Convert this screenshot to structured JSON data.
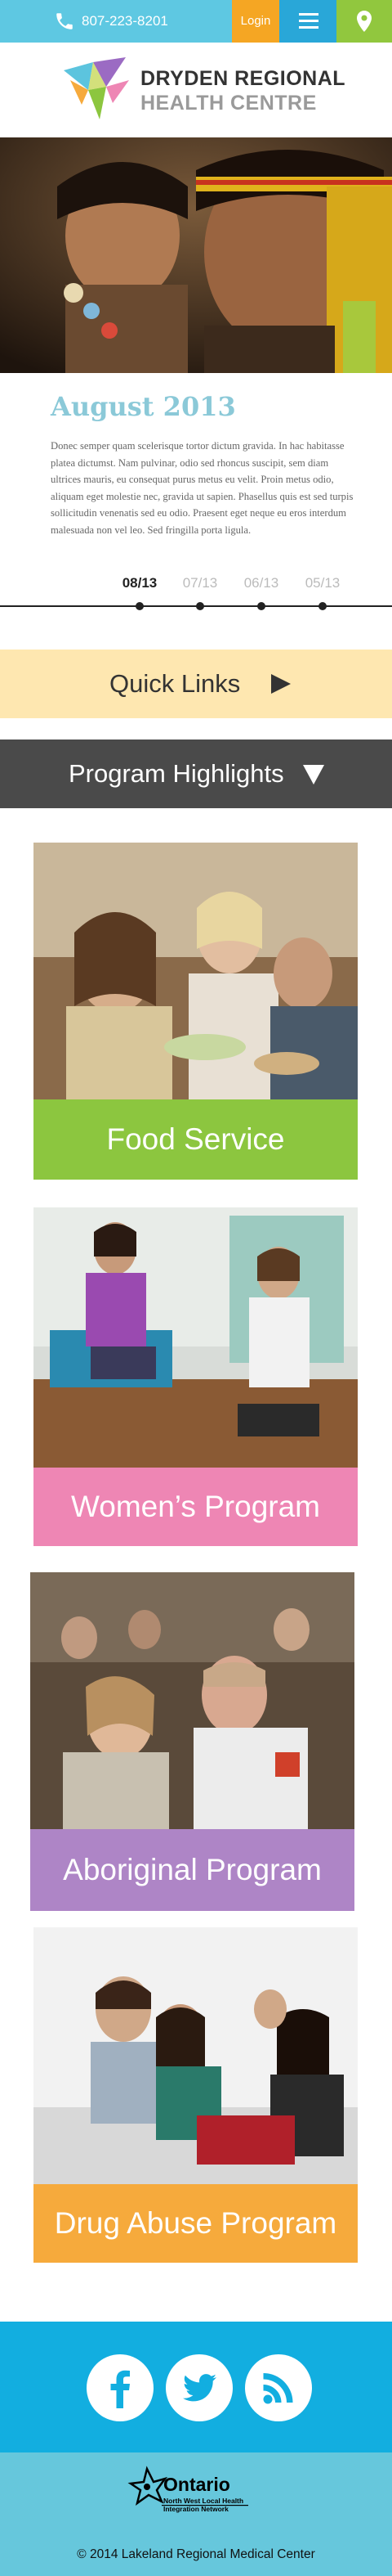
{
  "topbar": {
    "phone": "807-223-8201",
    "phone_icon": "phone-icon",
    "login_label": "Login",
    "menu_icon": "hamburger-menu-icon",
    "location_icon": "map-pin-icon",
    "colors": {
      "bar": "#5ec8e2",
      "login": "#f5a623",
      "menu": "#29a7d8",
      "location": "#91c73e"
    }
  },
  "header": {
    "title_line1": "DRYDEN REGIONAL",
    "title_line2": "HEALTH CENTRE"
  },
  "news": {
    "heading": "August 2013",
    "body": "Donec semper quam scelerisque tortor dictum gravida. In hac habitasse platea dictumst. Nam pulvinar, odio sed rhoncus suscipit, sem diam ultrices mauris, eu consequat purus metus eu velit. Proin metus odio, aliquam eget molestie nec, gravida ut sapien. Phasellus quis est sed turpis sollicitudin venenatis sed eu odio. Praesent eget neque eu eros interdum malesuada non vel leo. Sed fringilla porta ligula."
  },
  "timeline": {
    "items": [
      "08/13",
      "07/13",
      "06/13",
      "05/13"
    ],
    "active_index": 0
  },
  "quick_links": {
    "label": "Quick Links",
    "icon": "triangle-right-icon",
    "color": "#fee7b0"
  },
  "highlights": {
    "label": "Program Highlights",
    "icon": "triangle-down-icon",
    "color": "#4a4a4a"
  },
  "programs": [
    {
      "label": "Food Service",
      "color": "#8cc63f"
    },
    {
      "label": "Women’s Program",
      "color": "#ee86b4"
    },
    {
      "label": "Aboriginal Program",
      "color": "#ae85c6"
    },
    {
      "label": "Drug Abuse Program",
      "color": "#f6aa3c"
    }
  ],
  "footer": {
    "social": [
      {
        "name": "Facebook",
        "icon": "facebook-icon"
      },
      {
        "name": "Twitter",
        "icon": "twitter-icon"
      },
      {
        "name": "RSS",
        "icon": "rss-icon"
      }
    ],
    "ontario_name": "Ontario",
    "ontario_sub": "North West Local Health Integration Network",
    "copyright": "© 2014 Lakeland Regional Medical Center"
  }
}
